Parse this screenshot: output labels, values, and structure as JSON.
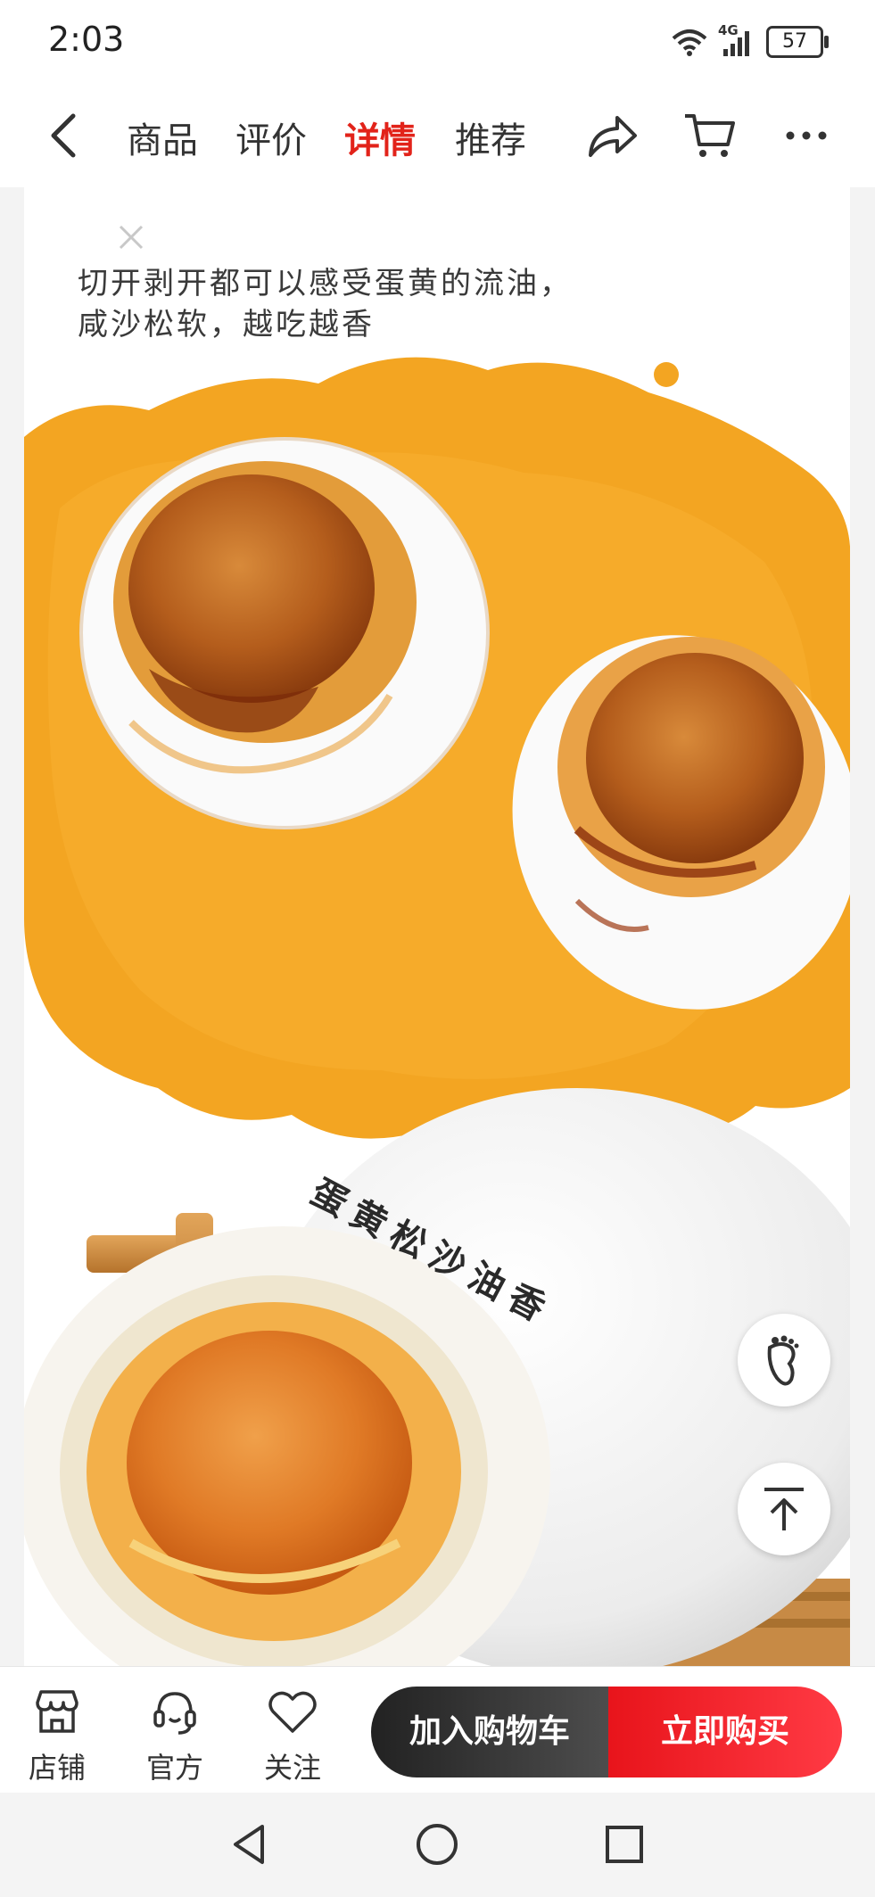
{
  "status_bar": {
    "time": "2:03",
    "network": "4G",
    "battery": "57"
  },
  "nav": {
    "tabs": [
      {
        "label": "商品"
      },
      {
        "label": "评价"
      },
      {
        "label": "详情"
      },
      {
        "label": "推荐"
      }
    ],
    "active_tab": "详情",
    "accent_color": "#e2231a"
  },
  "detail": {
    "caption_line1": "切开剥开都可以感受蛋黄的流油，",
    "caption_line2": "咸沙松软，越吃越香",
    "egg_text": "蛋黄松沙油香"
  },
  "bottom_bar": {
    "store_label": "店铺",
    "official_label": "官方",
    "follow_label": "关注",
    "add_to_cart_label": "加入购物车",
    "buy_now_label": "立即购买"
  },
  "icons": [
    "back-icon",
    "share-icon",
    "cart-icon",
    "more-icon",
    "close-icon",
    "footprint-icon",
    "back-to-top-icon",
    "store-icon",
    "headset-icon",
    "heart-icon"
  ]
}
